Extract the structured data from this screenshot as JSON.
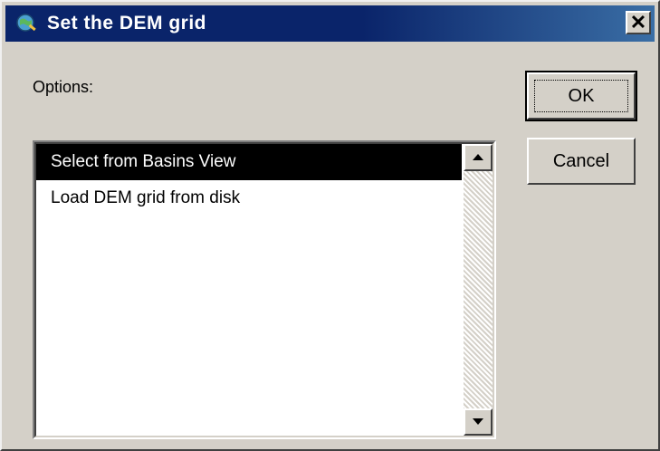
{
  "window": {
    "title": "Set the DEM grid",
    "icon": "arcview-globe-icon",
    "close_glyph": "✕"
  },
  "dialog": {
    "options_label": "Options:",
    "ok_label": "OK",
    "cancel_label": "Cancel",
    "list_items": [
      {
        "label": "Select from Basins View",
        "selected": true
      },
      {
        "label": "Load DEM grid from disk",
        "selected": false
      }
    ]
  },
  "colors": {
    "titlebar": "#0a246a",
    "face": "#d4d0c8",
    "selection": "#000000"
  }
}
